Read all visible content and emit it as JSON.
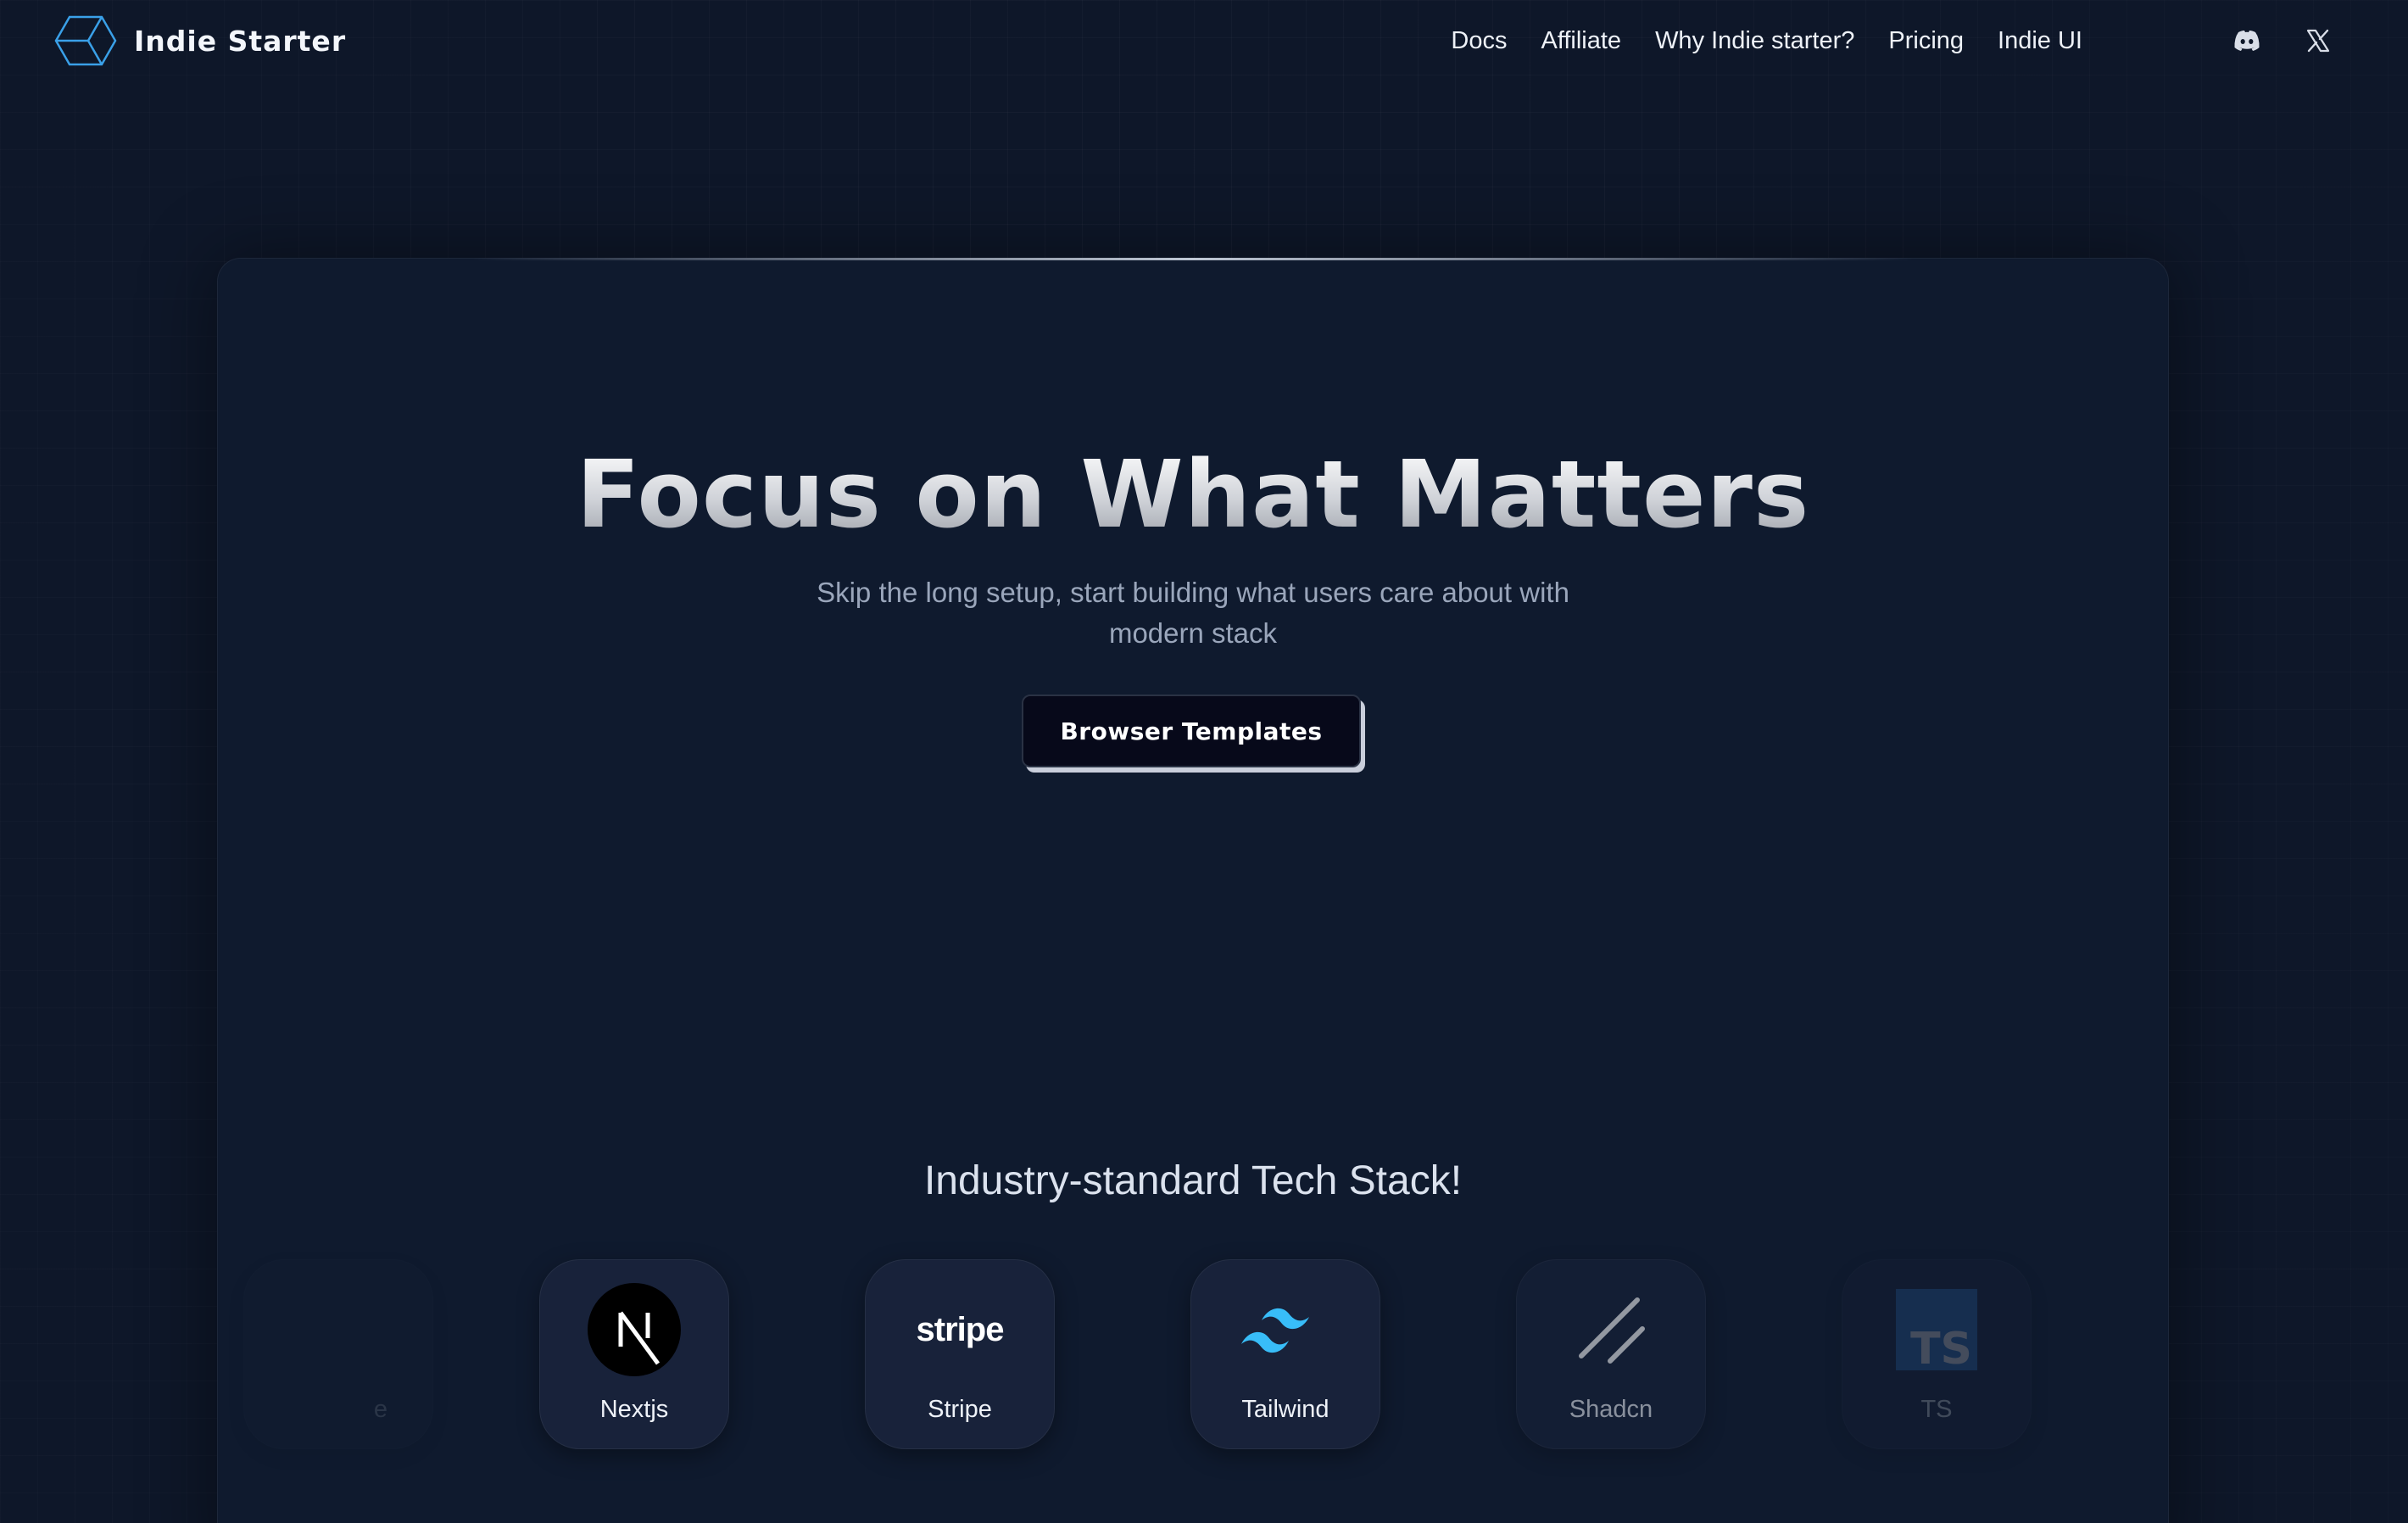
{
  "nav": {
    "brand": "Indie Starter",
    "links": [
      "Docs",
      "Affiliate",
      "Why Indie starter?",
      "Pricing",
      "Indie UI"
    ],
    "icons": [
      "discord-icon",
      "x-icon"
    ]
  },
  "hero": {
    "title": "Focus on What Matters",
    "subtitle": "Skip the long setup, start building what users care about with modern stack",
    "cta": "Browser Templates"
  },
  "stack": {
    "title": "Industry-standard Tech Stack!",
    "items": [
      {
        "label": "Nextjs",
        "icon": "nextjs-icon"
      },
      {
        "label": "Stripe",
        "icon": "stripe-icon"
      },
      {
        "label": "Tailwind",
        "icon": "tailwind-icon"
      },
      {
        "label": "Shadcn",
        "icon": "shadcn-icon"
      },
      {
        "label": "TS",
        "icon": "typescript-icon"
      }
    ],
    "partial_left_label": "e"
  },
  "colors": {
    "background": "#0e1729",
    "card": "#0f1a2e",
    "tile": "#18223a",
    "accent_logo": "#3aa0e8",
    "tailwind": "#38bdf8",
    "typescript": "#3178c6",
    "cta_bg": "#07091a"
  }
}
